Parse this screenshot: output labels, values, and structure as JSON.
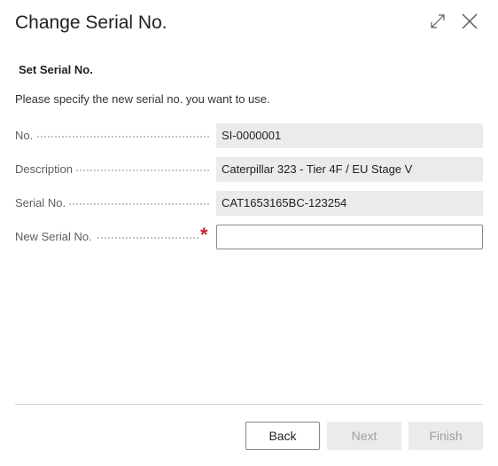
{
  "dialog": {
    "title": "Change Serial No."
  },
  "section": {
    "title": "Set Serial No.",
    "instructions": "Please specify the new serial no. you want to use."
  },
  "fields": {
    "no": {
      "label": "No.",
      "value": "SI-0000001"
    },
    "description": {
      "label": "Description",
      "value": "Caterpillar 323 - Tier 4F / EU Stage V"
    },
    "serial_no": {
      "label": "Serial No.",
      "value": "CAT1653165BC-123254"
    },
    "new_serial_no": {
      "label": "New Serial No.",
      "value": "",
      "required_mark": "*"
    }
  },
  "footer": {
    "back_label": "Back",
    "next_label": "Next",
    "finish_label": "Finish"
  },
  "icons": {
    "expand": "expand-icon",
    "close": "close-icon"
  }
}
